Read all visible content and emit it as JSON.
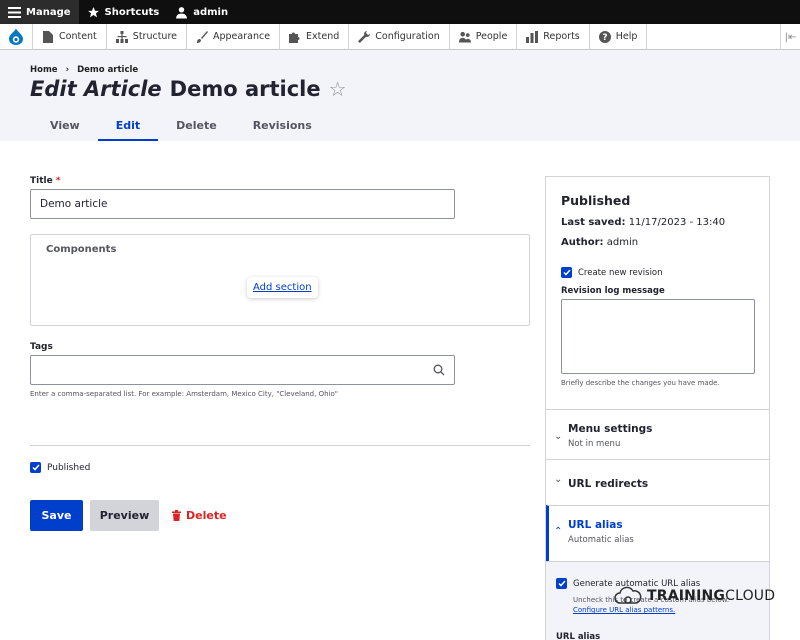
{
  "toolbar": {
    "manage": "Manage",
    "shortcuts": "Shortcuts",
    "user": "admin"
  },
  "admin_menu": {
    "items": [
      {
        "label": "Content",
        "icon": "document-icon"
      },
      {
        "label": "Structure",
        "icon": "sitemap-icon"
      },
      {
        "label": "Appearance",
        "icon": "paintbrush-icon"
      },
      {
        "label": "Extend",
        "icon": "puzzle-icon"
      },
      {
        "label": "Configuration",
        "icon": "wrench-icon"
      },
      {
        "label": "People",
        "icon": "people-icon"
      },
      {
        "label": "Reports",
        "icon": "bar-chart-icon"
      },
      {
        "label": "Help",
        "icon": "help-icon"
      }
    ]
  },
  "breadcrumb": {
    "home": "Home",
    "sep": "›",
    "current": "Demo article"
  },
  "page": {
    "title_prefix": "Edit Article",
    "title_name": "Demo article",
    "star": "☆"
  },
  "tabs": [
    "View",
    "Edit",
    "Delete",
    "Revisions"
  ],
  "form": {
    "title_label": "Title",
    "required_mark": "*",
    "title_value": "Demo article",
    "components_label": "Components",
    "add_section": "Add section",
    "tags_label": "Tags",
    "tags_help": "Enter a comma-separated list. For example: Amsterdam, Mexico City, \"Cleveland, Ohio\"",
    "published_label": "Published",
    "save": "Save",
    "preview": "Preview",
    "delete": "Delete"
  },
  "sidebar": {
    "status": "Published",
    "last_saved_label": "Last saved:",
    "last_saved_value": "11/17/2023 - 13:40",
    "author_label": "Author:",
    "author_value": "admin",
    "new_revision": "Create new revision",
    "revision_log_label": "Revision log message",
    "revision_log_help": "Briefly describe the changes you have made.",
    "menu_settings": "Menu settings",
    "menu_settings_sub": "Not in menu",
    "url_redirects": "URL redirects",
    "url_alias": "URL alias",
    "url_alias_sub": "Automatic alias",
    "generate_alias": "Generate automatic URL alias",
    "alias_help": "Uncheck this to create a custom alias below.",
    "configure_link": "Configure URL alias patterns.",
    "url_alias_field_label": "URL alias"
  },
  "watermark": {
    "bold": "TRAINING",
    "light": "CLOUD"
  },
  "colors": {
    "accent": "#003ecc",
    "danger": "#dc2323",
    "header_bg": "#f3f4f9"
  }
}
